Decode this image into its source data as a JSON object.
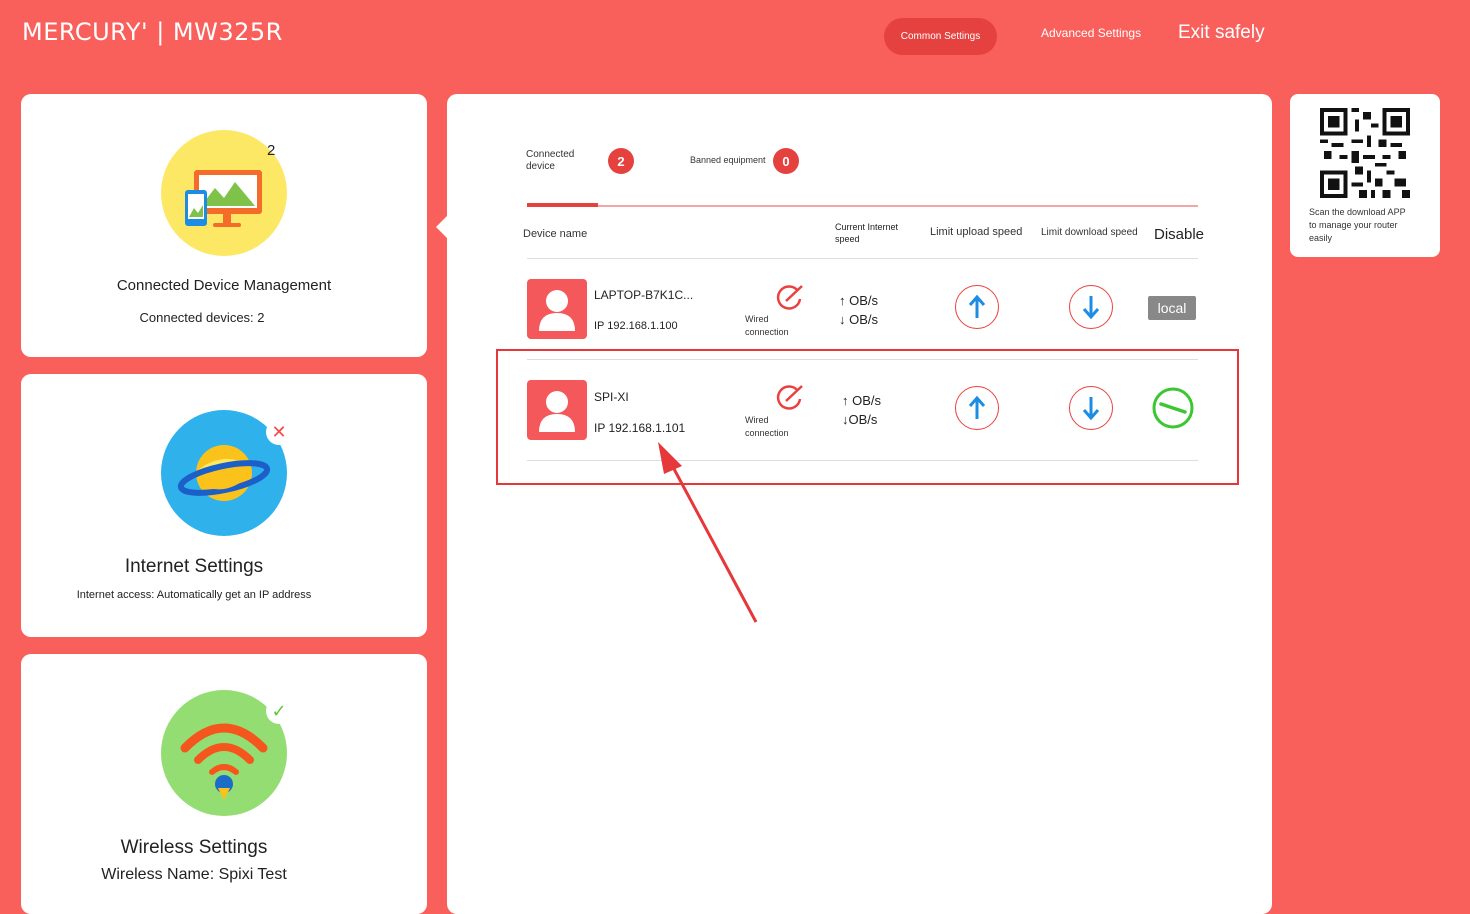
{
  "header": {
    "brand": "MERCURY' | MW325R",
    "nav_common": "Common Settings",
    "nav_advanced": "Advanced Settings",
    "nav_exit": "Exit safely"
  },
  "cards": {
    "device": {
      "badge": "2",
      "title": "Connected Device Management",
      "sub": "Connected devices: 2"
    },
    "internet": {
      "title": "Internet Settings",
      "sub": "Internet access: Automatically get an IP address"
    },
    "wireless": {
      "title": "Wireless Settings",
      "sub": "Wireless Name: Spixi Test"
    }
  },
  "tabs": {
    "connected_label_1": "Connected",
    "connected_label_2": "device",
    "connected_count": "2",
    "banned_label": "Banned equipment",
    "banned_count": "0"
  },
  "columns": {
    "device_name": "Device name",
    "speed_1": "Current Internet",
    "speed_2": "speed",
    "upload": "Limit upload speed",
    "download": "Limit download speed",
    "disable": "Disable"
  },
  "devices": [
    {
      "name": "LAPTOP-B7K1C...",
      "ip": "IP 192.168.1.100",
      "conn_1": "Wired",
      "conn_2": "connection",
      "up": "↑ OB/s",
      "down": "↓ OB/s",
      "disable": "local"
    },
    {
      "name": "SPI-XI",
      "ip": "IP 192.168.1.101",
      "conn_1": "Wired",
      "conn_2": "connection",
      "up": "↑ OB/s",
      "down": "↓OB/s"
    }
  ],
  "qr": {
    "line1": "Scan the download APP",
    "line2": "to manage your router",
    "line3": "easily"
  },
  "colors": {
    "background": "#f9605c",
    "accent": "#e5413f",
    "highlight": "#e6373a"
  }
}
